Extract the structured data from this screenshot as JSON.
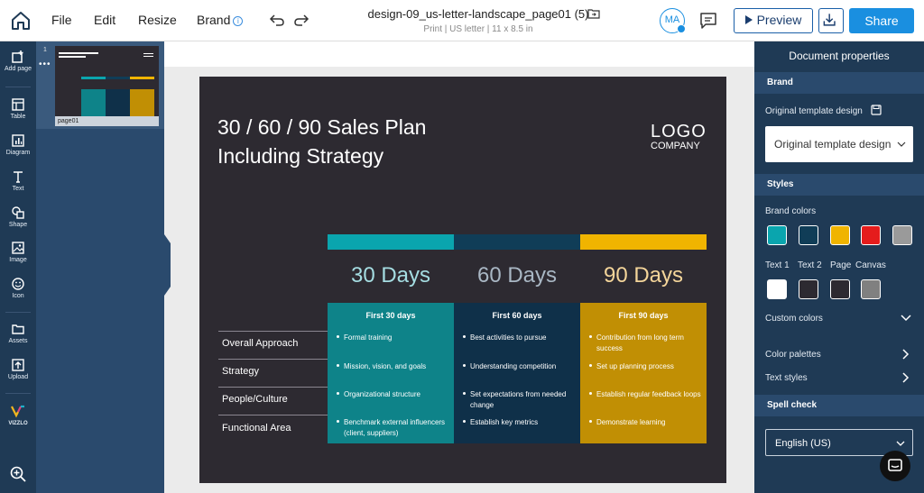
{
  "menu": {
    "file": "File",
    "edit": "Edit",
    "resize": "Resize",
    "brand": "Brand"
  },
  "document": {
    "title": "design-09_us-letter-landscape_page01 (5)",
    "subtitle": "Print | US letter | 11 x 8.5 in"
  },
  "user": {
    "initials": "MA"
  },
  "actions": {
    "preview": "Preview",
    "share": "Share"
  },
  "left_toolbar": [
    {
      "label": "Add page",
      "icon": "add-page-icon"
    },
    {
      "label": "Table",
      "icon": "table-icon"
    },
    {
      "label": "Diagram",
      "icon": "diagram-icon"
    },
    {
      "label": "Text",
      "icon": "text-icon"
    },
    {
      "label": "Shape",
      "icon": "shape-icon"
    },
    {
      "label": "Image",
      "icon": "image-icon"
    },
    {
      "label": "Icon",
      "icon": "smiley-icon"
    },
    {
      "label": "Assets",
      "icon": "folder-icon"
    },
    {
      "label": "Upload",
      "icon": "upload-icon"
    },
    {
      "label": "VIZZLO",
      "icon": "vizzlo-logo"
    }
  ],
  "pages": [
    {
      "number": "1",
      "label": "page01"
    }
  ],
  "slide": {
    "title": "30 / 60 / 90 Sales Plan\nIncluding Strategy",
    "logo": "LOGO",
    "logo_sub": "COMPANY",
    "columns": [
      {
        "label": "30 Days",
        "header": "First 30 days",
        "band_color": "#0aa5ae",
        "bg_color": "#0e8389",
        "label_color": "#a5dde2",
        "cells": [
          "Formal training",
          "Mission, vision, and goals",
          "Organizational structure",
          "Benchmark external influencers (client, suppliers)"
        ]
      },
      {
        "label": "60 Days",
        "header": "First 60 days",
        "band_color": "#103d57",
        "bg_color": "#0f3049",
        "label_color": "#a9b7c4",
        "cells": [
          "Best activities to pursue",
          "Understanding competition",
          "Set expectations from needed change",
          "Establish key metrics"
        ]
      },
      {
        "label": "90 Days",
        "header": "First 90 days",
        "band_color": "#f0b400",
        "bg_color": "#c18f04",
        "label_color": "#f4d59a",
        "cells": [
          "Contribution from long term success",
          "Set up planning process",
          "Establish regular feedback loops",
          "Demonstrate learning"
        ]
      }
    ],
    "rows": [
      "Overall Approach",
      "Strategy",
      "People/Culture",
      "Functional Area"
    ]
  },
  "right_panel": {
    "title": "Document properties",
    "brand_section": "Brand",
    "original_template_label": "Original template design",
    "original_template_value": "Original template design",
    "styles_section": "Styles",
    "brand_colors_label": "Brand colors",
    "brand_colors": [
      "#0aa5ae",
      "#103d57",
      "#f0b400",
      "#e51c1c",
      "#9a9a9a"
    ],
    "text_labels": [
      "Text 1",
      "Text 2",
      "Page",
      "Canvas"
    ],
    "text_colors": [
      "#ffffff",
      "#2d2a31",
      "#2d2a31",
      "#808080"
    ],
    "custom_colors": "Custom colors",
    "color_palettes": "Color palettes",
    "text_styles": "Text styles",
    "spell_check_section": "Spell check",
    "language": "English (US)"
  }
}
